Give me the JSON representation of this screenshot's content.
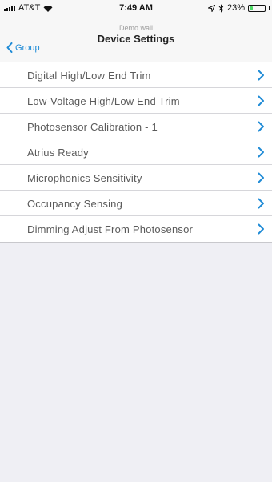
{
  "status_bar": {
    "carrier": "AT&T",
    "time": "7:49 AM",
    "battery_percent": "23%",
    "battery_level": 0.23
  },
  "nav": {
    "back_label": "Group",
    "subtitle": "Demo wall",
    "title": "Device Settings"
  },
  "settings": {
    "items": [
      {
        "label": "Digital High/Low End Trim"
      },
      {
        "label": "Low-Voltage High/Low End Trim"
      },
      {
        "label": "Photosensor Calibration - 1"
      },
      {
        "label": "Atrius Ready"
      },
      {
        "label": "Microphonics Sensitivity"
      },
      {
        "label": "Occupancy Sensing"
      },
      {
        "label": "Dimming Adjust From Photosensor"
      }
    ]
  },
  "colors": {
    "accent": "#1f8bd6",
    "background": "#efeff4",
    "battery": "#4cd964"
  }
}
